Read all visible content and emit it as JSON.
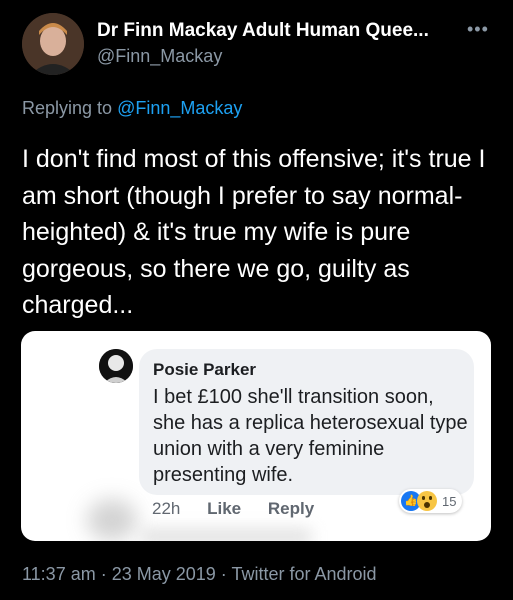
{
  "author": {
    "display_name": "Dr Finn Mackay Adult Human Quee...",
    "handle": "@Finn_Mackay"
  },
  "reply": {
    "prefix": "Replying to ",
    "to": "@Finn_Mackay"
  },
  "tweet": {
    "text": "I don't find most of this offensive; it's true I am short (though I prefer to say normal-heighted) & it's true my wife is pure gorgeous, so there we go, guilty as charged..."
  },
  "embedded_comment": {
    "name": "Posie Parker",
    "text": "I bet £100 she'll transition soon, she has a replica heterosexual type union with a very feminine presenting wife.",
    "time": "22h",
    "like_label": "Like",
    "reply_label": "Reply",
    "reaction_count": "15"
  },
  "meta": {
    "time": "11:37 am",
    "date": "23 May 2019",
    "source": "Twitter for Android",
    "separator": " · "
  },
  "icons": {
    "more": "more-icon",
    "like_reaction": "like-reaction-icon",
    "wow_reaction": "wow-reaction-icon"
  },
  "colors": {
    "background": "#000000",
    "link": "#1da1f2",
    "secondary_text": "#8b98a5"
  }
}
